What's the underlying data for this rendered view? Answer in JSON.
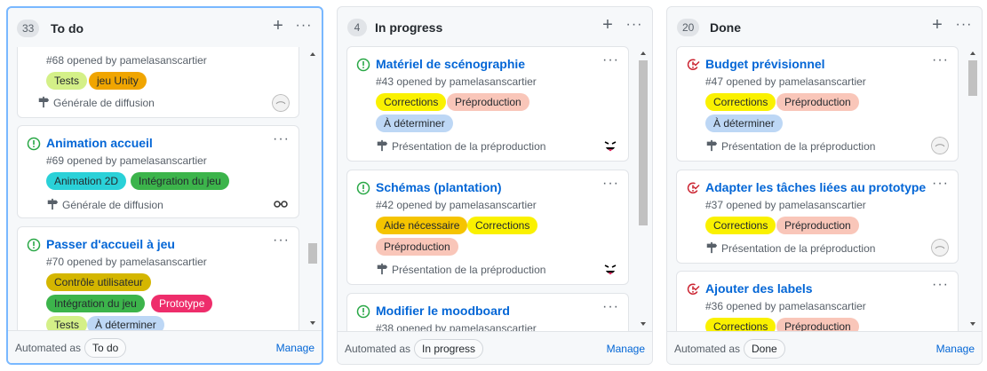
{
  "columns": [
    {
      "count": "33",
      "title": "To do",
      "automated_label": "Automated as",
      "automated_value": "To do",
      "manage": "Manage",
      "cards": [
        {
          "title": "",
          "status": "open",
          "meta": "#68 opened by pamelasanscartier",
          "labels": [
            {
              "text": "Tests",
              "bg": "#d4f088",
              "fg": "#24292e"
            },
            {
              "text": "jeu Unity",
              "bg": "#f0a500",
              "fg": "#24292e"
            }
          ],
          "milestone": "Générale de diffusion",
          "avatar": "avatar-gray"
        },
        {
          "title": "Animation accueil",
          "status": "open",
          "meta": "#69 opened by pamelasanscartier",
          "labels": [
            {
              "text": "Animation 2D",
              "bg": "#2ad1d8",
              "fg": "#24292e"
            },
            {
              "text": "Intégration du jeu",
              "bg": "#3cb44b",
              "fg": "#24292e"
            }
          ],
          "milestone": "Générale de diffusion",
          "avatar": "avatar-glasses"
        },
        {
          "title": "Passer d'accueil à jeu",
          "status": "open",
          "meta": "#70 opened by pamelasanscartier",
          "labels": [
            {
              "text": "Contrôle utilisateur",
              "bg": "#d4b600",
              "fg": "#24292e"
            },
            {
              "text": "Intégration du jeu",
              "bg": "#3cb44b",
              "fg": "#24292e"
            },
            {
              "text": "Prototype",
              "bg": "#ee2d6b",
              "fg": "#ffffff"
            },
            {
              "text": "Tests",
              "bg": "#d4f088",
              "fg": "#24292e"
            },
            {
              "text": "À déterminer",
              "bg": "#bdd7f5",
              "fg": "#24292e"
            }
          ]
        }
      ]
    },
    {
      "count": "4",
      "title": "In progress",
      "automated_label": "Automated as",
      "automated_value": "In progress",
      "manage": "Manage",
      "cards": [
        {
          "title": "Matériel de scénographie",
          "status": "open",
          "meta": "#43 opened by pamelasanscartier",
          "labels": [
            {
              "text": "Corrections",
              "bg": "#faf100",
              "fg": "#24292e"
            },
            {
              "text": "Préproduction",
              "bg": "#f9c6b9",
              "fg": "#24292e"
            },
            {
              "text": "À déterminer",
              "bg": "#bdd7f5",
              "fg": "#24292e"
            }
          ],
          "milestone": "Présentation de la préproduction",
          "avatar": "avatar-face"
        },
        {
          "title": "Schémas (plantation)",
          "status": "open",
          "meta": "#42 opened by pamelasanscartier",
          "labels": [
            {
              "text": "Aide nécessaire",
              "bg": "#f5c400",
              "fg": "#24292e"
            },
            {
              "text": "Corrections",
              "bg": "#faf100",
              "fg": "#24292e"
            },
            {
              "text": "Préproduction",
              "bg": "#f9c6b9",
              "fg": "#24292e"
            }
          ],
          "milestone": "Présentation de la préproduction",
          "avatar": "avatar-face"
        },
        {
          "title": "Modifier le moodboard",
          "status": "open",
          "meta": "#38 opened by pamelasanscartier",
          "labels": []
        }
      ]
    },
    {
      "count": "20",
      "title": "Done",
      "automated_label": "Automated as",
      "automated_value": "Done",
      "manage": "Manage",
      "cards": [
        {
          "title": "Budget prévisionnel",
          "status": "closed",
          "meta": "#47 opened by pamelasanscartier",
          "labels": [
            {
              "text": "Corrections",
              "bg": "#faf100",
              "fg": "#24292e"
            },
            {
              "text": "Préproduction",
              "bg": "#f9c6b9",
              "fg": "#24292e"
            },
            {
              "text": "À déterminer",
              "bg": "#bdd7f5",
              "fg": "#24292e"
            }
          ],
          "milestone": "Présentation de la préproduction",
          "avatar": "avatar-gray"
        },
        {
          "title": "Adapter les tâches liées au prototype",
          "status": "closed",
          "meta": "#37 opened by pamelasanscartier",
          "labels": [
            {
              "text": "Corrections",
              "bg": "#faf100",
              "fg": "#24292e"
            },
            {
              "text": "Préproduction",
              "bg": "#f9c6b9",
              "fg": "#24292e"
            }
          ],
          "milestone": "Présentation de la préproduction",
          "avatar": "avatar-gray"
        },
        {
          "title": "Ajouter des labels",
          "status": "closed",
          "meta": "#36 opened by pamelasanscartier",
          "labels": [
            {
              "text": "Corrections",
              "bg": "#faf100",
              "fg": "#24292e"
            },
            {
              "text": "Préproduction",
              "bg": "#f9c6b9",
              "fg": "#24292e"
            }
          ]
        }
      ]
    }
  ],
  "icons": {
    "open_issue": "issue-opened-icon",
    "closed_issue": "issue-closed-icon",
    "milestone": "milestone-icon",
    "add": "plus-icon",
    "more": "kebab-horizontal-icon"
  },
  "colors": {
    "accent": "#0366d6",
    "open_green": "#28a745",
    "closed_red": "#cb2431",
    "selected_border": "#79b8ff"
  }
}
